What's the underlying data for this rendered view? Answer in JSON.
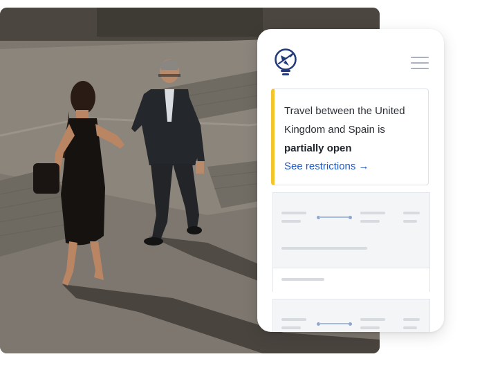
{
  "alert": {
    "text_before": "Travel between the United Kingdom and Spain is ",
    "status_bold": "partially open",
    "link_label": "See restrictions →"
  },
  "colors": {
    "brand_navy": "#223a7a",
    "link_blue": "#1d58c4",
    "alert_accent": "#f3c52a",
    "menu_gray": "#a9b2bd",
    "skeleton_gray": "#d7dbe0"
  },
  "icons": {
    "logo": "plane-lightbulb-icon",
    "menu": "hamburger-menu-icon"
  }
}
